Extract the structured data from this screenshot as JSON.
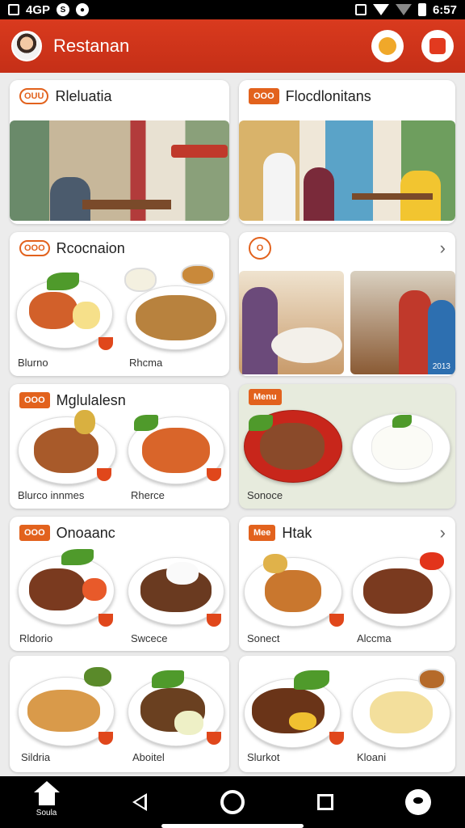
{
  "status_bar": {
    "carrier": "4GP",
    "time": "6:57"
  },
  "app_bar": {
    "title": "Restanan",
    "avatar": "chef-avatar",
    "actions": [
      "profile-icon",
      "cart-icon"
    ]
  },
  "cards": [
    {
      "tag": "OUU",
      "title": "Rleluatia",
      "image": "restaurant-interior-photo"
    },
    {
      "tag": "OOO",
      "title": "Flocdlonitans",
      "image": "restaurant-dining-photo"
    },
    {
      "tag": "OOO",
      "title": "Rcocnaion",
      "dishes": [
        "Blurno",
        "Rhcma"
      ]
    },
    {
      "tag": "O",
      "title": "",
      "chevron": "›",
      "photo_caption": "2013"
    },
    {
      "tag": "OOO",
      "title": "Mglulalesn",
      "dishes": [
        "Blurco innmes",
        "Rherce"
      ]
    },
    {
      "tag": "Menu",
      "title": "",
      "dishes": [
        "Sonoce",
        ""
      ]
    },
    {
      "tag": "OOO",
      "title": "Onoaanc",
      "dishes": [
        "Rldorio",
        "Swcece"
      ]
    },
    {
      "tag": "Mee",
      "title": "Htak",
      "chevron": "›",
      "dishes": [
        "Sonect",
        "Alccma"
      ]
    },
    {
      "tag": "",
      "title": "",
      "dishes": [
        "Sildria",
        "Aboitel"
      ]
    },
    {
      "tag": "",
      "title": "",
      "dishes": [
        "Slurkot",
        "Kloani"
      ]
    }
  ],
  "nav": {
    "home_label": "Soula"
  },
  "colors": {
    "brand": "#d93a1e",
    "accent": "#e2621d"
  }
}
